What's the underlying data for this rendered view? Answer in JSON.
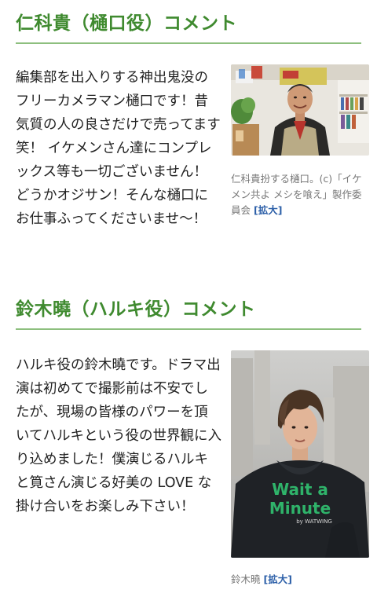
{
  "sections": [
    {
      "heading": "仁科貴（樋口役）コメント",
      "body": "編集部を出入りする神出鬼没のフリーカメラマン樋口です！昔気質の人の良さだけで売ってます笑！ イケメンさん達にコンプレックス等も一切ございません！ どうかオジサン！そんな樋口にお仕事ふってくださいませ〜！",
      "caption": "仁科貴扮する樋口。(c)「イケメン共よ メシを喰え」製作委員会",
      "enlarge_label": "[拡大]"
    },
    {
      "heading": "鈴木曉（ハルキ役）コメント",
      "body": "ハルキ役の鈴木曉です。ドラマ出演は初めてで撮影前は不安でしたが、現場の皆様のパワーを頂いてハルキという役の世界観に入り込めました！僕演じるハルキと筧さん演じる好美の LOVE な掛け合いをお楽しみ下さい！",
      "caption": "鈴木曉",
      "enlarge_label": "[拡大]",
      "hoodie_text_line1": "Wait a",
      "hoodie_text_line2": "Minute",
      "hoodie_brand": "by WATWING"
    }
  ],
  "colors": {
    "heading": "#3f8a2f",
    "rule": "#8dbf7e",
    "link": "#2c5fa8",
    "caption": "#777777",
    "hoodie_print": "#2fb36a"
  }
}
